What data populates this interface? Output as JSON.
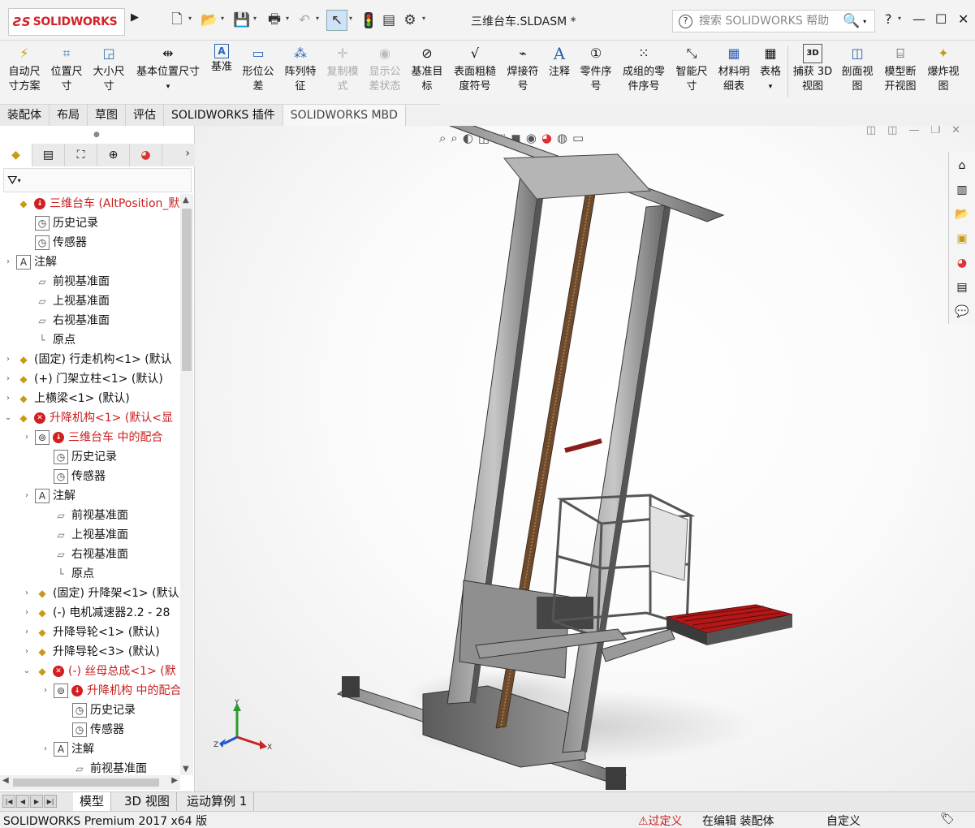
{
  "app": {
    "logo_ds": "ƧS",
    "logo_text": "SOLIDWORKS",
    "document_title": "三维台车.SLDASM *"
  },
  "quick_access": [
    "new-icon",
    "open-icon",
    "save-icon",
    "print-icon",
    "undo-icon",
    "select-icon",
    "traffic-light-icon",
    "file-props-icon",
    "options-icon"
  ],
  "help": {
    "placeholder": "搜索 SOLIDWORKS 帮助",
    "question": "?"
  },
  "ribbon": {
    "buttons": [
      {
        "l1": "自动尺",
        "l2": "寸方案",
        "icon": "⚡",
        "enabled": true
      },
      {
        "l1": "位置尺",
        "l2": "寸",
        "icon": "⌗",
        "enabled": true
      },
      {
        "l1": "大小尺",
        "l2": "寸",
        "icon": "◲",
        "enabled": true
      },
      {
        "l1": "基本位置尺寸",
        "l2": "▾",
        "icon": "⇹",
        "enabled": true
      },
      {
        "l1": "基准",
        "l2": "",
        "icon": "A",
        "enabled": true
      },
      {
        "l1": "形位公",
        "l2": "差",
        "icon": "▭",
        "enabled": true
      },
      {
        "l1": "阵列特",
        "l2": "征",
        "icon": "⁂",
        "enabled": true
      },
      {
        "l1": "复制模",
        "l2": "式",
        "icon": "✛",
        "enabled": false
      },
      {
        "l1": "显示公",
        "l2": "差状态",
        "icon": "◉",
        "enabled": false
      },
      {
        "l1": "基准目",
        "l2": "标",
        "icon": "⊘",
        "enabled": true
      },
      {
        "l1": "表面粗糙",
        "l2": "度符号",
        "icon": "√",
        "enabled": true
      },
      {
        "l1": "焊接符",
        "l2": "号",
        "icon": "⌁",
        "enabled": true
      },
      {
        "l1": "注释",
        "l2": "",
        "icon": "A",
        "enabled": true
      },
      {
        "l1": "零件序",
        "l2": "号",
        "icon": "①",
        "enabled": true
      },
      {
        "l1": "成组的零",
        "l2": "件序号",
        "icon": "⁙",
        "enabled": true
      },
      {
        "l1": "智能尺",
        "l2": "寸",
        "icon": "⤡",
        "enabled": true
      },
      {
        "l1": "材料明",
        "l2": "细表",
        "icon": "▦",
        "enabled": true
      },
      {
        "l1": "表格",
        "l2": "▾",
        "icon": "▦",
        "enabled": true
      },
      {
        "l1": "捕获 3D",
        "l2": "视图",
        "icon": "3D",
        "enabled": true
      },
      {
        "l1": "剖面视",
        "l2": "图",
        "icon": "◫",
        "enabled": true
      },
      {
        "l1": "模型断",
        "l2": "开视图",
        "icon": "⌸",
        "enabled": true
      },
      {
        "l1": "爆炸视",
        "l2": "图",
        "icon": "✦",
        "enabled": true
      }
    ]
  },
  "command_tabs": [
    "装配体",
    "布局",
    "草图",
    "评估",
    "SOLIDWORKS 插件",
    "SOLIDWORKS MBD"
  ],
  "tree": [
    {
      "d": 0,
      "ex": "",
      "icon": "asm",
      "warn": "down",
      "label": "三维台车  (AltPosition_默",
      "red": true
    },
    {
      "d": 1,
      "ex": "",
      "icon": "doc",
      "label": "历史记录"
    },
    {
      "d": 1,
      "ex": "",
      "icon": "doc",
      "label": "传感器"
    },
    {
      "d": 0,
      "ex": "›",
      "icon": "note",
      "label": "注解"
    },
    {
      "d": 1,
      "ex": "",
      "icon": "plane",
      "label": "前视基准面"
    },
    {
      "d": 1,
      "ex": "",
      "icon": "plane",
      "label": "上视基准面"
    },
    {
      "d": 1,
      "ex": "",
      "icon": "plane",
      "label": "右视基准面"
    },
    {
      "d": 1,
      "ex": "",
      "icon": "origin",
      "label": "原点"
    },
    {
      "d": 0,
      "ex": "›",
      "icon": "part",
      "label": "(固定) 行走机构<1> (默认"
    },
    {
      "d": 0,
      "ex": "›",
      "icon": "part",
      "label": "(+) 门架立柱<1> (默认)"
    },
    {
      "d": 0,
      "ex": "›",
      "icon": "part",
      "label": "上横梁<1> (默认)"
    },
    {
      "d": 0,
      "ex": "⌄",
      "icon": "asm",
      "warn": "x",
      "label": "升降机构<1> (默认<显",
      "red": true
    },
    {
      "d": 1,
      "ex": "›",
      "icon": "mate",
      "warn": "down",
      "label": "三维台车 中的配合",
      "red": true
    },
    {
      "d": 2,
      "ex": "",
      "icon": "doc",
      "label": "历史记录"
    },
    {
      "d": 2,
      "ex": "",
      "icon": "doc",
      "label": "传感器"
    },
    {
      "d": 1,
      "ex": "›",
      "icon": "note",
      "label": "注解"
    },
    {
      "d": 2,
      "ex": "",
      "icon": "plane",
      "label": "前视基准面"
    },
    {
      "d": 2,
      "ex": "",
      "icon": "plane",
      "label": "上视基准面"
    },
    {
      "d": 2,
      "ex": "",
      "icon": "plane",
      "label": "右视基准面"
    },
    {
      "d": 2,
      "ex": "",
      "icon": "origin",
      "label": "原点"
    },
    {
      "d": 1,
      "ex": "›",
      "icon": "part",
      "label": "(固定) 升降架<1> (默认"
    },
    {
      "d": 1,
      "ex": "›",
      "icon": "part",
      "label": "(-) 电机减速器2.2 - 28"
    },
    {
      "d": 1,
      "ex": "›",
      "icon": "part",
      "label": "升降导轮<1> (默认)"
    },
    {
      "d": 1,
      "ex": "›",
      "icon": "part",
      "label": "升降导轮<3> (默认)"
    },
    {
      "d": 1,
      "ex": "⌄",
      "icon": "asm",
      "warn": "x",
      "label": "(-) 丝母总成<1> (默",
      "red": true
    },
    {
      "d": 2,
      "ex": "›",
      "icon": "mate",
      "warn": "down",
      "label": "升降机构 中的配合",
      "red": true
    },
    {
      "d": 3,
      "ex": "",
      "icon": "doc",
      "label": "历史记录"
    },
    {
      "d": 3,
      "ex": "",
      "icon": "doc",
      "label": "传感器"
    },
    {
      "d": 2,
      "ex": "›",
      "icon": "note",
      "label": "注解"
    },
    {
      "d": 3,
      "ex": "",
      "icon": "plane",
      "label": "前视基准面"
    }
  ],
  "bottom_tabs": [
    "模型",
    "3D 视图",
    "运动算例 1"
  ],
  "status": {
    "product": "SOLIDWORKS Premium 2017 x64 版",
    "warning": "⚠过定义",
    "mode": "在编辑 装配体",
    "custom": "自定义"
  },
  "triad": {
    "x": "X",
    "y": "Y",
    "z": "Z"
  }
}
